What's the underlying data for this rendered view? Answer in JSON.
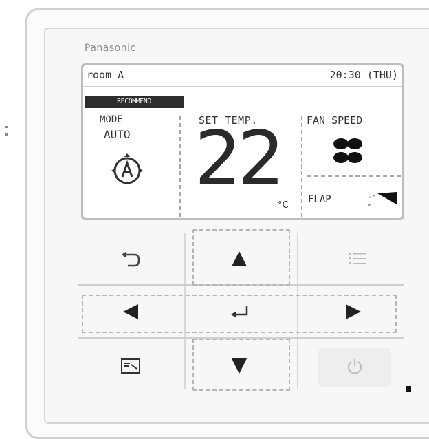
{
  "brand": "Panasonic",
  "lcd": {
    "room": "room A",
    "time": "20:30 (THU)",
    "label_bar": "RECOMMEND",
    "mode_heading": "MODE",
    "mode_value": "AUTO",
    "mode_icon": "auto-mode-icon",
    "set_temp_heading": "SET TEMP.",
    "set_temp_value": "22",
    "temp_unit": "°C",
    "fan_speed_heading": "FAN SPEED",
    "fan_icon": "fan-icon",
    "flap_heading": "FLAP",
    "flap_icon": "flap-angle-icon"
  },
  "buttons": {
    "return_icon": "return-icon",
    "up_icon": "up-arrow-icon",
    "menu_icon": "menu-icon",
    "left_icon": "left-arrow-icon",
    "enter_icon": "enter-icon",
    "right_icon": "right-arrow-icon",
    "quick_menu_icon": "quick-menu-icon",
    "down_icon": "down-arrow-icon",
    "power_icon": "power-icon"
  },
  "colors": {
    "lcd_frame": "#bdbdbd",
    "label_bar": "#2d2d2d",
    "body": "#f7f7f7",
    "indicator": "#111111"
  }
}
